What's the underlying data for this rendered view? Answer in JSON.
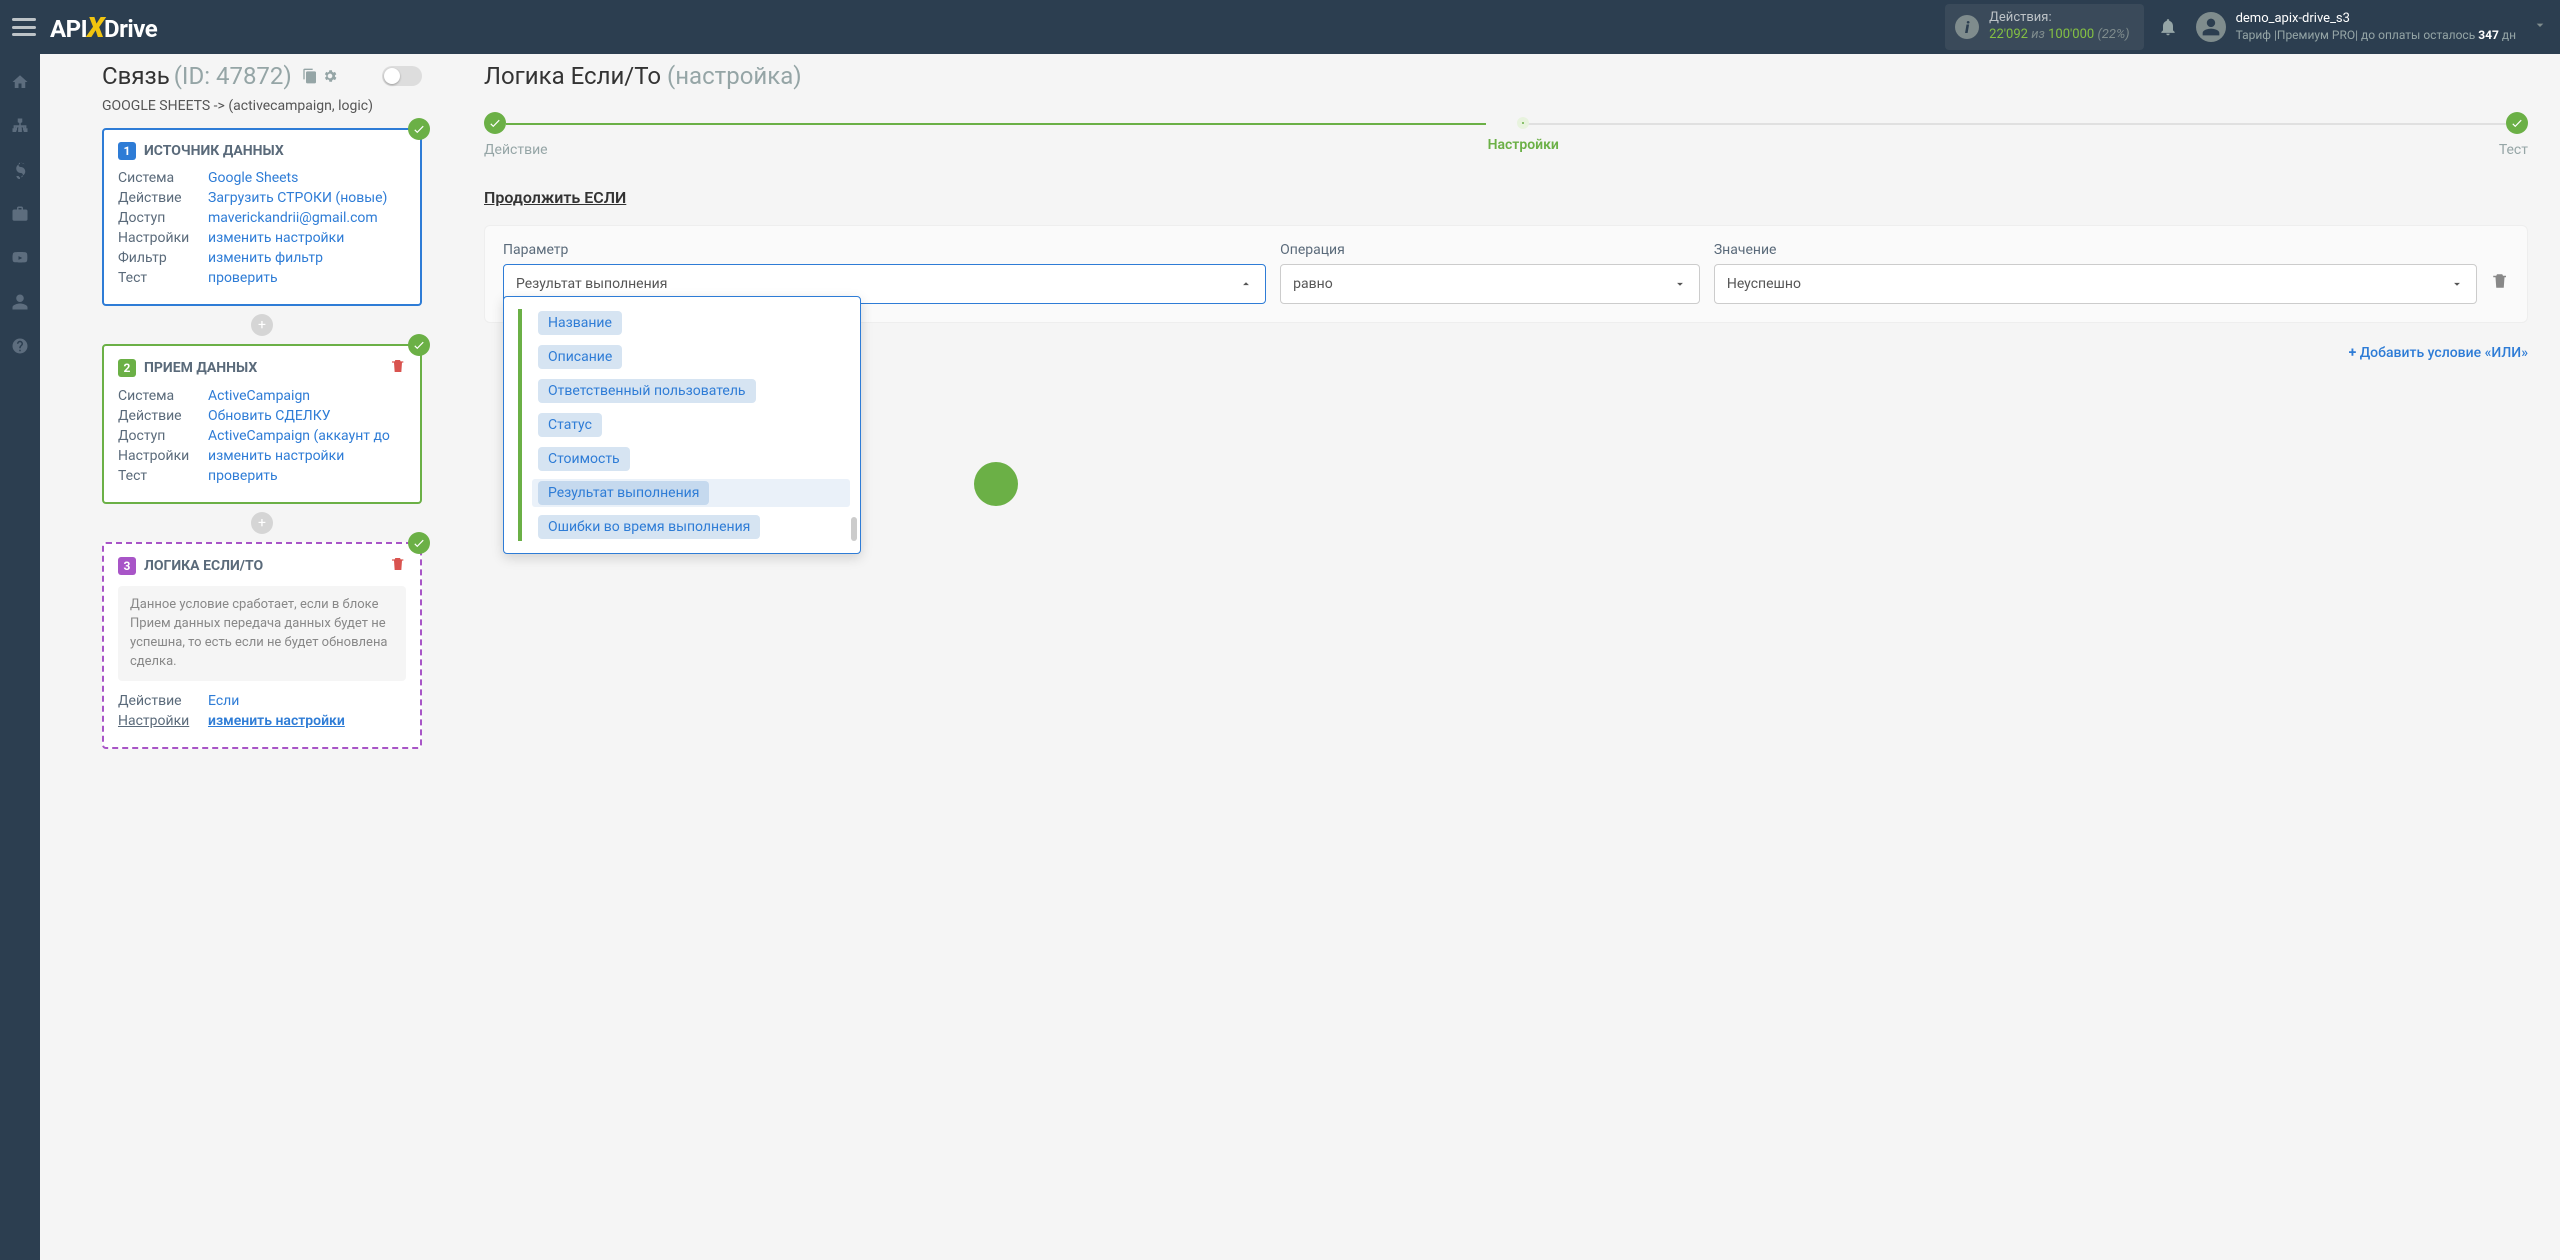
{
  "topbar": {
    "logo": {
      "api": "API",
      "x": "X",
      "drive": "Drive"
    },
    "actions": {
      "label": "Действия:",
      "count": "22'092",
      "of": "из",
      "total": "100'000",
      "pct": "(22%)"
    },
    "user": {
      "name": "demo_apix-drive_s3",
      "tariff_prefix": "Тариф |Премиум PRO| до оплаты осталось ",
      "days": "347",
      "days_suffix": " дн"
    }
  },
  "connection": {
    "title": "Связь",
    "id": "(ID: 47872)",
    "subtitle": "GOOGLE SHEETS -> (activecampaign, logic)"
  },
  "block1": {
    "num": "1",
    "title": "ИСТОЧНИК ДАННЫХ",
    "rows": {
      "system_lbl": "Система",
      "system_val": "Google Sheets",
      "action_lbl": "Действие",
      "action_val": "Загрузить СТРОКИ (новые)",
      "access_lbl": "Доступ",
      "access_val": "maverickandrii@gmail.com",
      "settings_lbl": "Настройки",
      "settings_val": "изменить настройки",
      "filter_lbl": "Фильтр",
      "filter_val": "изменить фильтр",
      "test_lbl": "Тест",
      "test_val": "проверить"
    }
  },
  "block2": {
    "num": "2",
    "title": "ПРИЕМ ДАННЫХ",
    "rows": {
      "system_lbl": "Система",
      "system_val": "ActiveCampaign",
      "action_lbl": "Действие",
      "action_val": "Обновить СДЕЛКУ",
      "access_lbl": "Доступ",
      "access_val": "ActiveCampaign (аккаунт до",
      "settings_lbl": "Настройки",
      "settings_val": "изменить настройки",
      "test_lbl": "Тест",
      "test_val": "проверить"
    }
  },
  "block3": {
    "num": "3",
    "title": "ЛОГИКА ЕСЛИ/ТО",
    "note": "Данное условие сработает, если в блоке Прием данных передача данных будет не успешна, то есть если не будет обновлена сделка.",
    "rows": {
      "action_lbl": "Действие",
      "action_val": "Если",
      "settings_lbl": "Настройки",
      "settings_val": "изменить настройки"
    }
  },
  "main": {
    "title": "Логика Если/То",
    "title_sub": "(настройка)",
    "steps": {
      "s1": "Действие",
      "s2": "Настройки",
      "s3": "Тест"
    },
    "continue_if": "Продолжить ЕСЛИ",
    "labels": {
      "param": "Параметр",
      "op": "Операция",
      "val": "Значение"
    },
    "selected": {
      "param": "Результат выполнения",
      "op": "равно",
      "val": "Неуспешно"
    },
    "add_or": "Добавить условие «ИЛИ»",
    "options": {
      "o1": "Название",
      "o2": "Описание",
      "o3": "Ответственный пользователь",
      "o4": "Статус",
      "o5": "Стоимость",
      "o6": "Результат выполнения",
      "o7": "Ошибки во время выполнения"
    }
  }
}
